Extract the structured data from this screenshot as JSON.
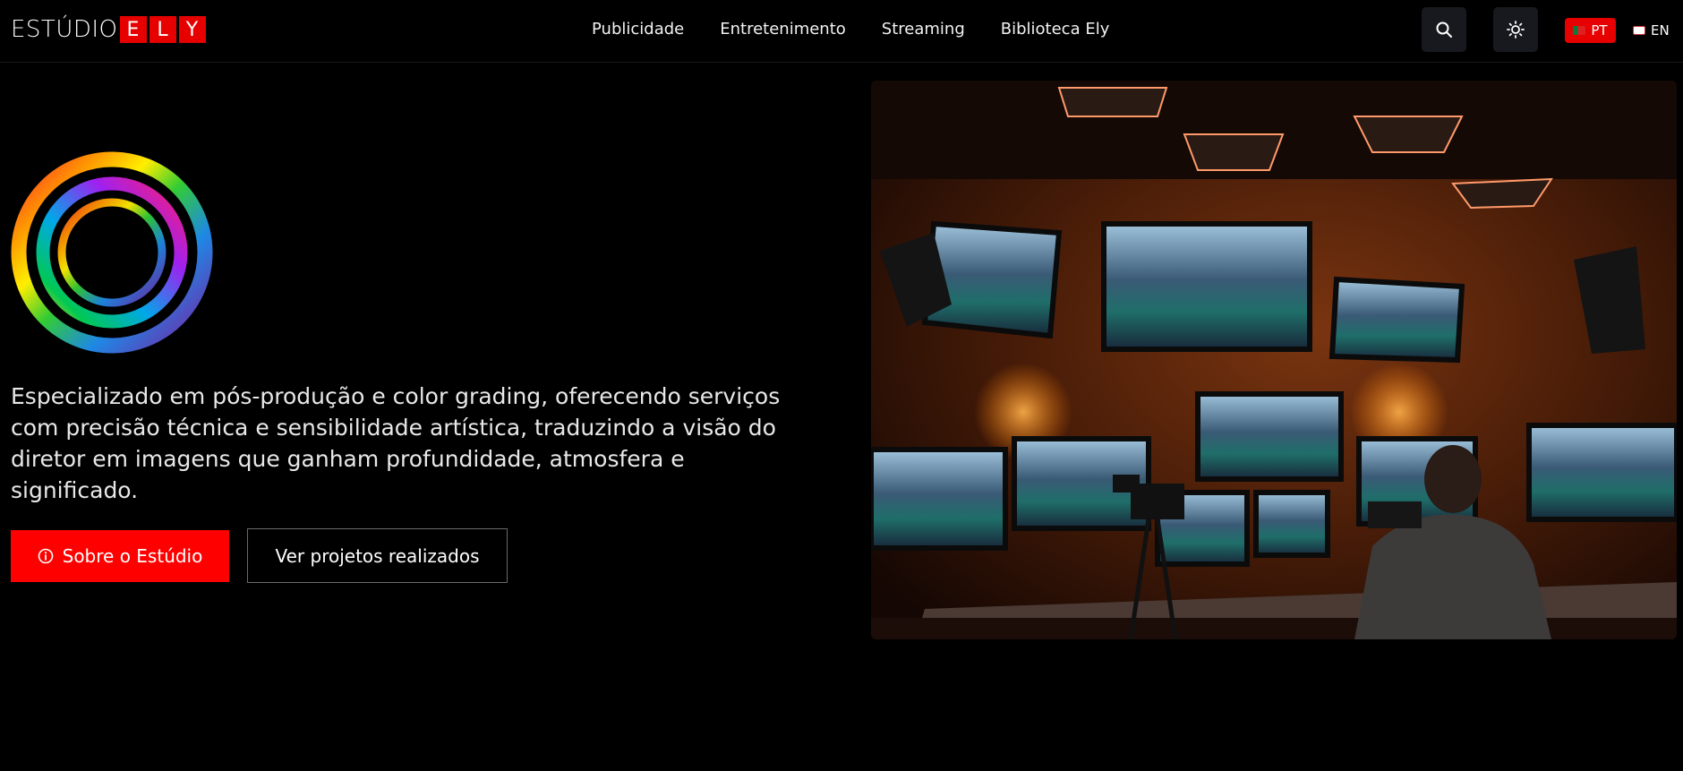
{
  "logo": {
    "word": "ESTÚDIO",
    "tiles": [
      "E",
      "L",
      "Y"
    ],
    "brand_color": "#e60000"
  },
  "nav": {
    "items": [
      {
        "label": "Publicidade"
      },
      {
        "label": "Entretenimento"
      },
      {
        "label": "Streaming"
      },
      {
        "label": "Biblioteca Ely"
      }
    ]
  },
  "header_actions": {
    "search_icon": "search-icon",
    "theme_icon": "sun-icon",
    "lang_pt": "PT",
    "lang_en": "EN",
    "active_lang_color": "#e60000"
  },
  "hero": {
    "description": "Especializado em pós-produção e color grading, oferecendo serviços com precisão técnica e sensibilidade artística, traduzindo a visão do diretor em imagens que ganham profundidade, atmosfera e significado.",
    "primary_button": "Sobre o Estúdio",
    "secondary_button": "Ver projetos realizados",
    "primary_color": "#ff0000",
    "image_icon": "studio-editing-room-photo"
  }
}
